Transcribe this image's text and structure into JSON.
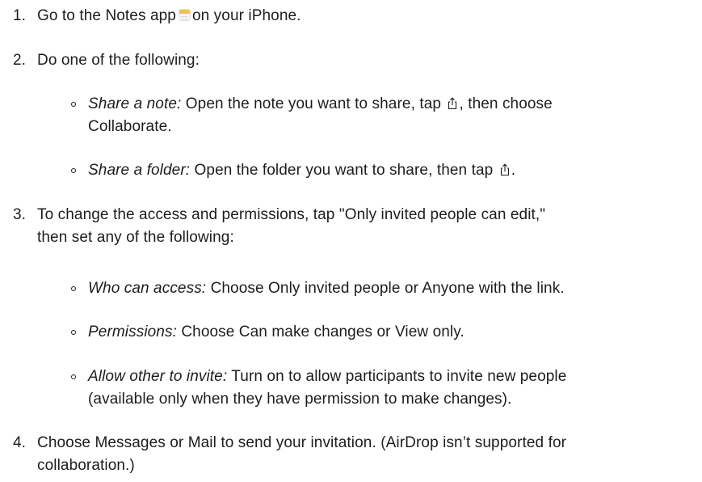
{
  "steps": [
    {
      "number": "1.",
      "text_before": "Go to the Notes app",
      "icon": "notes-app-icon",
      "text_after": "on your iPhone."
    },
    {
      "number": "2.",
      "text": "Do one of the following:",
      "sub_items": [
        {
          "term": "Share a note:",
          "text_before": "Open the note you want to share, tap",
          "icon": "share-icon",
          "text_after": ", then choose",
          "text_line2": "Collaborate."
        },
        {
          "term": "Share a folder:",
          "text_before": "Open the folder you want to share, then tap",
          "icon": "share-icon",
          "text_after": "."
        }
      ]
    },
    {
      "number": "3.",
      "text_line1": "To change the access and permissions, tap \"Only invited people can edit,\"",
      "text_line2": "then set any of the following:",
      "sub_items": [
        {
          "term": "Who can access:",
          "text": "Choose Only invited people or Anyone with the link."
        },
        {
          "term": "Permissions:",
          "text": "Choose Can make changes or View only."
        },
        {
          "term": "Allow other to invite:",
          "text": "Turn on to allow participants to invite new people",
          "text_line2": "(available only when they have permission to make changes)."
        }
      ]
    },
    {
      "number": "4.",
      "text_line1": "Choose Messages or Mail to send your invitation. (AirDrop isn’t supported for",
      "text_line2": "collaboration.)"
    }
  ]
}
